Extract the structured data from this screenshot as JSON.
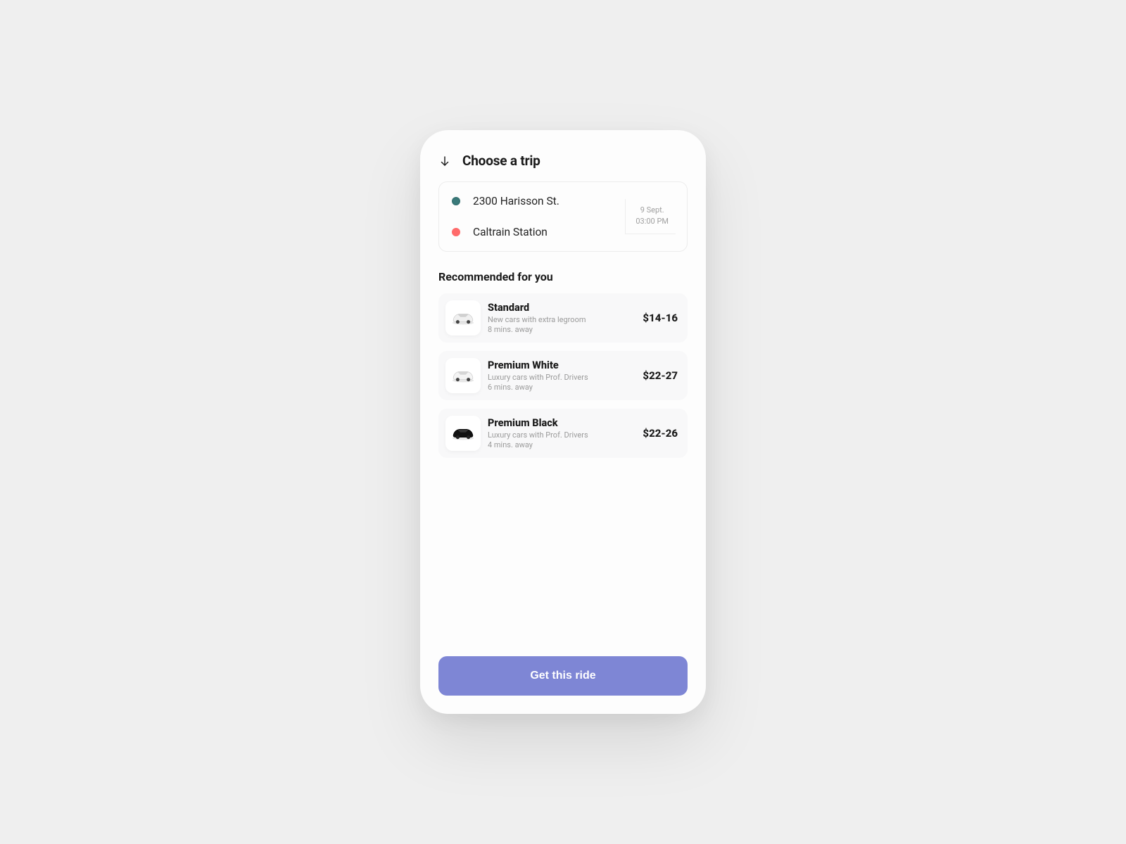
{
  "header": {
    "title": "Choose a trip"
  },
  "trip": {
    "pickup": "2300 Harisson St.",
    "destination": "Caltrain Station",
    "date": "9 Sept.",
    "time": "03:00 PM"
  },
  "recommended_heading": "Recommended for you",
  "options": [
    {
      "name": "Standard",
      "desc": "New cars with extra legroom",
      "eta": "8 mins. away",
      "price": "$14-16",
      "car_color": "white"
    },
    {
      "name": "Premium White",
      "desc": "Luxury cars with Prof. Drivers",
      "eta": "6 mins. away",
      "price": "$22-27",
      "car_color": "white"
    },
    {
      "name": "Premium Black",
      "desc": "Luxury cars with Prof. Drivers",
      "eta": "4 mins. away",
      "price": "$22-26",
      "car_color": "black"
    }
  ],
  "cta_label": "Get this ride"
}
